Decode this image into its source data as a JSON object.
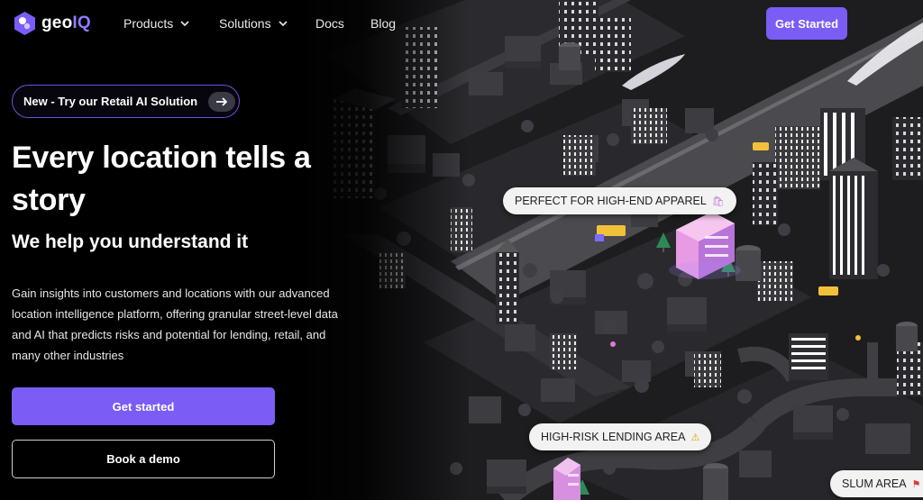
{
  "brand": {
    "name_prefix": "geo",
    "name_suffix": "IQ",
    "accent": "#7b5cf5"
  },
  "nav": {
    "items": [
      {
        "label": "Products",
        "has_dropdown": true
      },
      {
        "label": "Solutions",
        "has_dropdown": true
      },
      {
        "label": "Docs",
        "has_dropdown": false
      },
      {
        "label": "Blog",
        "has_dropdown": false
      }
    ],
    "cta": "Get Started"
  },
  "hero": {
    "announcement": "New - Try our Retail AI Solution",
    "headline": "Every location tells a story",
    "subheadline": "We help you understand it",
    "description": "Gain insights into customers and locations with our advanced location intelligence platform, offering granular street-level data and AI that predicts risks and potential for lending, retail, and many other industries",
    "primary_button": "Get started",
    "secondary_button": "Book a demo"
  },
  "map_labels": {
    "apparel": {
      "text": "PERFECT FOR HIGH-END APPAREL",
      "icon": "shopping-bag-icon",
      "glyph": "🛍"
    },
    "lending": {
      "text": "HIGH-RISK LENDING AREA",
      "icon": "warning-icon",
      "glyph": "⚠"
    },
    "slum": {
      "text": "SLUM AREA",
      "icon": "red-flag-icon",
      "glyph": "⚑"
    }
  }
}
